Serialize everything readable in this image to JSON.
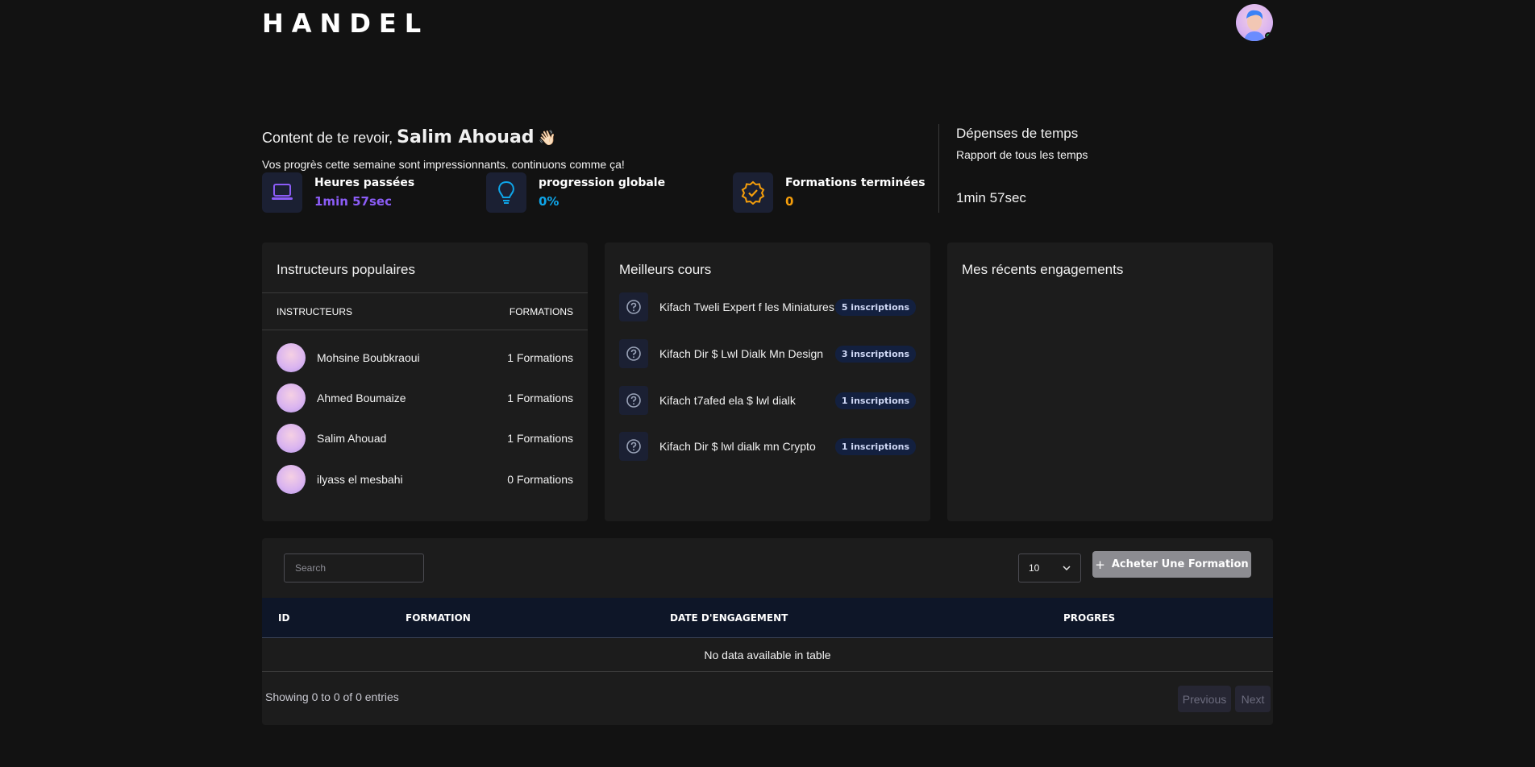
{
  "header": {
    "logo": "HANDEL",
    "avatar_status_color": "#22c55e"
  },
  "welcome": {
    "greeting": "Content de te revoir,",
    "name": "Salim Ahouad",
    "wave": "👋🏻",
    "subtitle": "Vos progrès cette semaine sont impressionnants. continuons comme ça!"
  },
  "stats": [
    {
      "label": "Heures passées",
      "value": "1min 57sec",
      "icon": "laptop-icon",
      "color": "#8b5cf6"
    },
    {
      "label": "progression globale",
      "value": "0%",
      "icon": "lightbulb-icon",
      "color": "#0ea5e9"
    },
    {
      "label": "Formations terminées",
      "value": "0",
      "icon": "badge-check-icon",
      "color": "#f59e0b"
    }
  ],
  "time_spent": {
    "title": "Dépenses de temps",
    "subtitle": "Rapport de tous les temps",
    "value": "1min 57sec"
  },
  "instructors": {
    "title": "Instructeurs populaires",
    "col_instructors": "INSTRUCTEURS",
    "col_formations": "FORMATIONS",
    "rows": [
      {
        "name": "Mohsine Boubkraoui",
        "formations": "1 Formations"
      },
      {
        "name": "Ahmed Boumaize",
        "formations": "1 Formations"
      },
      {
        "name": "Salim Ahouad",
        "formations": "1 Formations"
      },
      {
        "name": "ilyass el mesbahi",
        "formations": "0 Formations"
      }
    ]
  },
  "courses": {
    "title": "Meilleurs cours",
    "rows": [
      {
        "title": "Kifach Tweli Expert f les Miniatures",
        "badge": "5 inscriptions"
      },
      {
        "title": "Kifach Dir $ Lwl Dialk Mn Design",
        "badge": "3 inscriptions"
      },
      {
        "title": "Kifach t7afed ela $ lwl dialk",
        "badge": "1 inscriptions"
      },
      {
        "title": "Kifach Dir $ lwl dialk mn Crypto",
        "badge": "1 inscriptions"
      }
    ]
  },
  "engagements": {
    "title": "Mes récents engagements"
  },
  "table": {
    "search_placeholder": "Search",
    "page_size": "10",
    "buy_button": "Acheter Une Formation",
    "buy_icon": "+",
    "columns": [
      "ID",
      "FORMATION",
      "DATE D'ENGAGEMENT",
      "PROGRES"
    ],
    "empty_text": "No data available in table",
    "showing": "Showing 0 to 0 of 0 entries",
    "prev": "Previous",
    "next": "Next"
  }
}
